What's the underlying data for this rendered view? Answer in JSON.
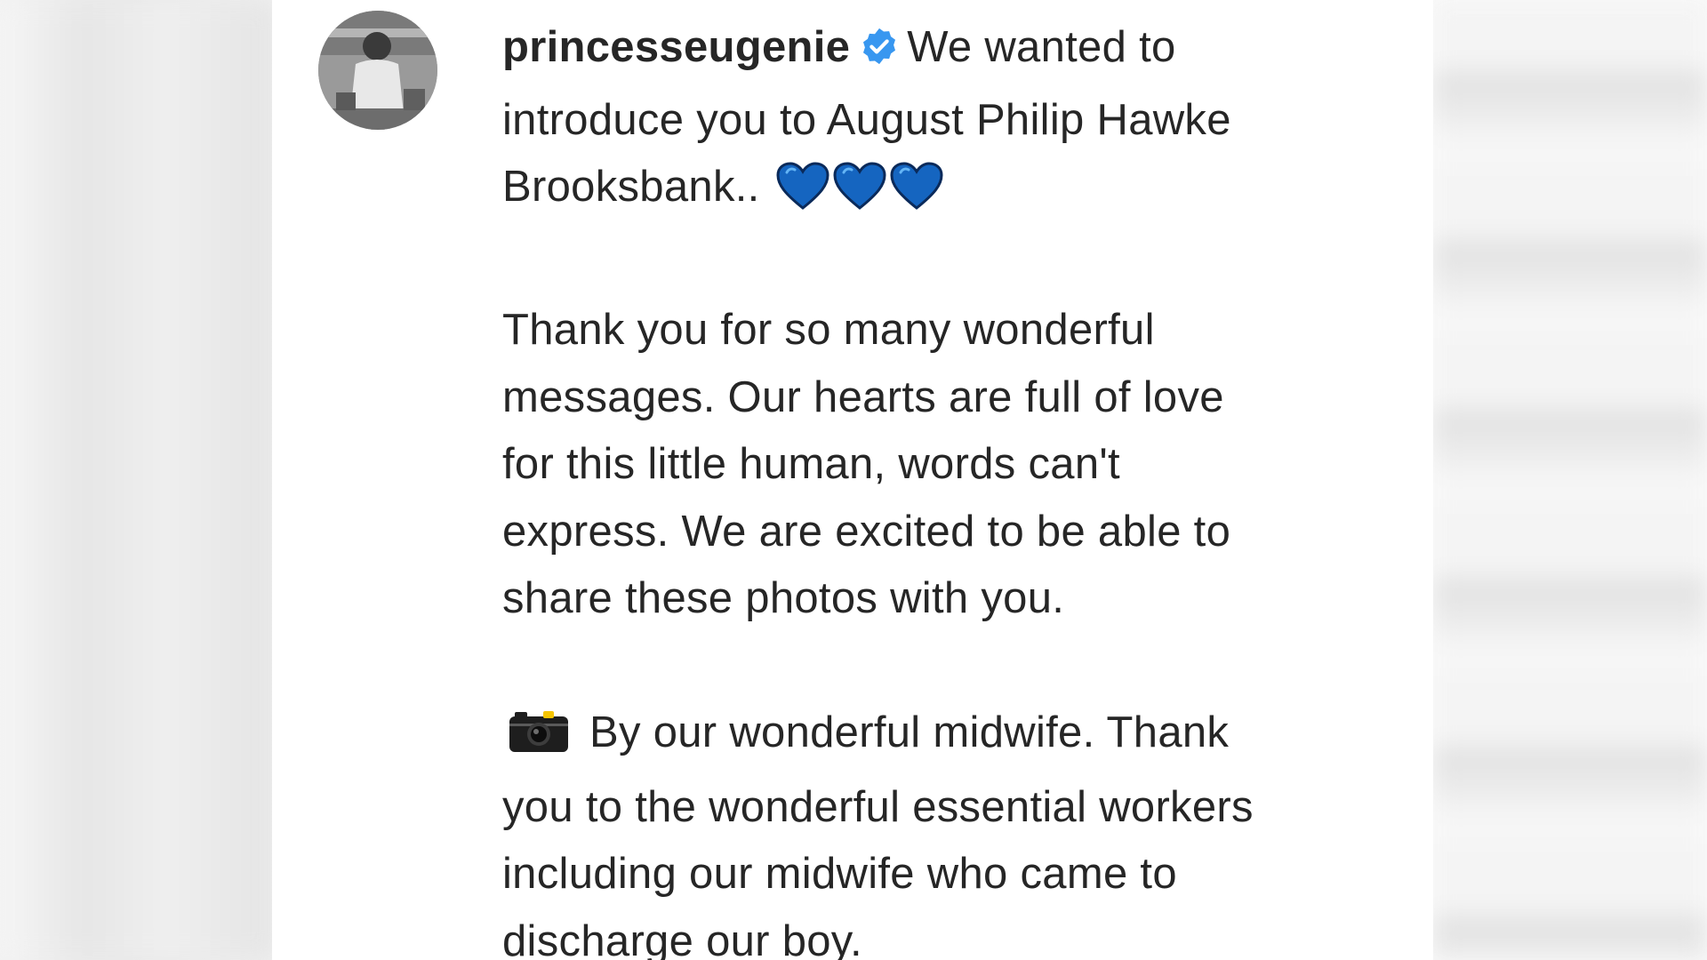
{
  "post": {
    "username": "princesseugenie",
    "verified": true,
    "icons": {
      "verified": "verified-badge-icon",
      "heart": "blue-heart-icon",
      "camera": "camera-icon"
    },
    "colors": {
      "verified_badge": "#3897f0",
      "heart": "#1565c0",
      "text": "#262626"
    },
    "caption": {
      "line1": "We wanted to",
      "line2": "introduce you to August Philip Hawke",
      "line3": "Brooksbank..",
      "para2": [
        "Thank you for so many wonderful",
        "messages. Our hearts are full of love",
        "for this little human, words can't",
        "express. We are excited to be able to",
        "share these photos with you."
      ],
      "para3_first": "By our wonderful midwife. Thank",
      "para3": [
        "you to the wonderful essential workers",
        "including our midwife who came to",
        "discharge our boy."
      ]
    }
  }
}
